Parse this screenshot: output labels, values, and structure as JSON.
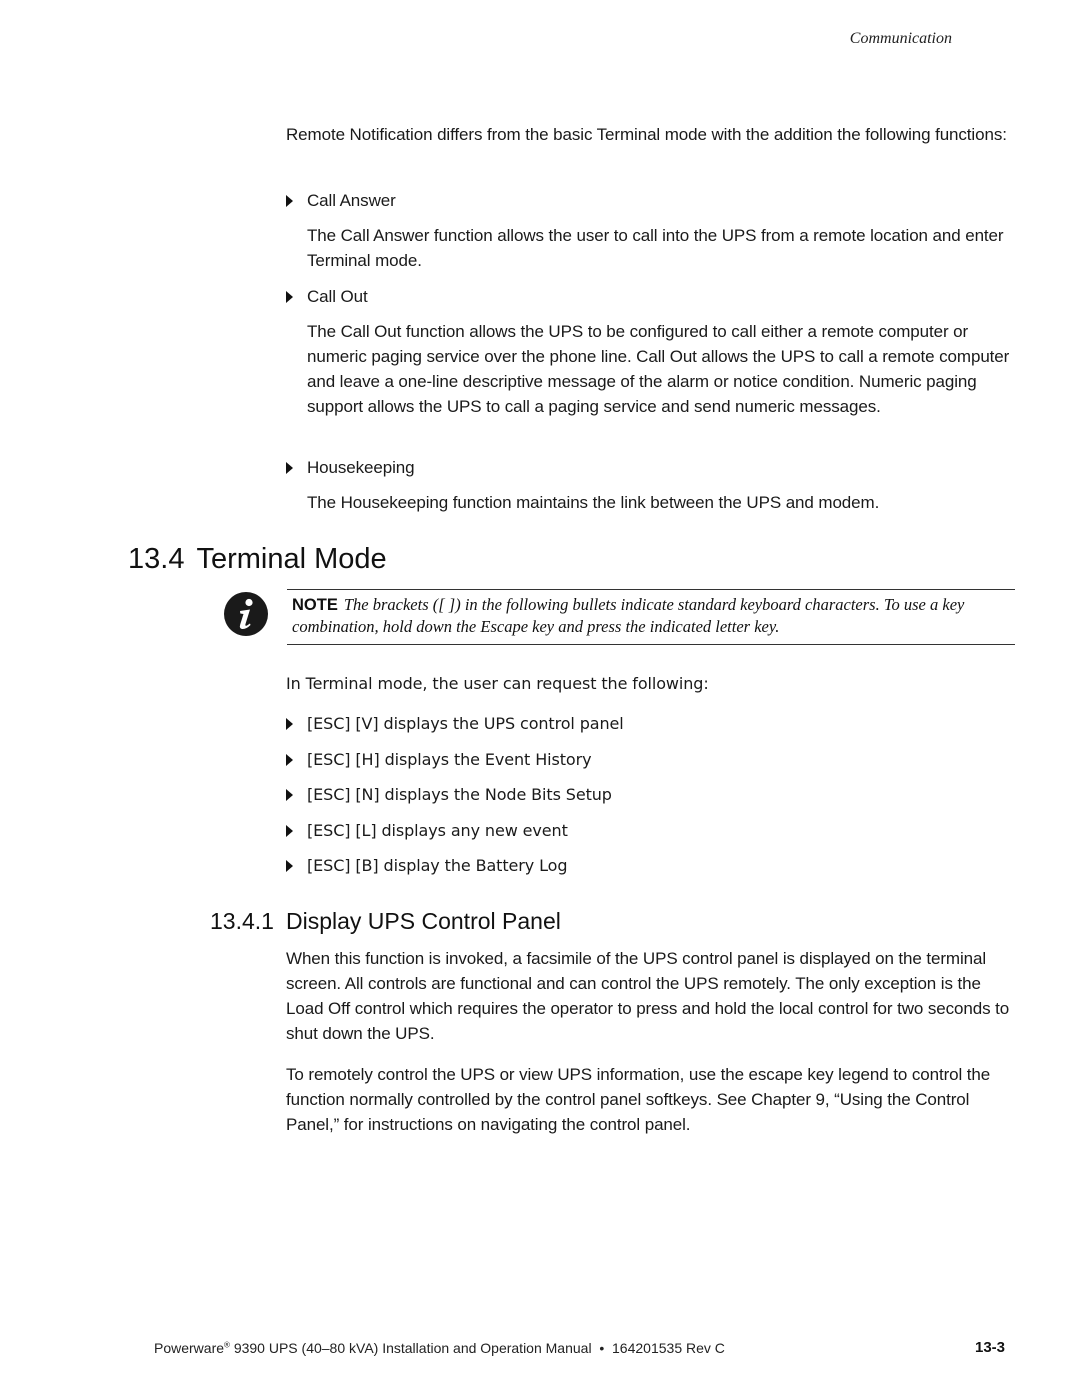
{
  "header": {
    "running_head": "Communication"
  },
  "intro": {
    "paragraph": "Remote Notification differs from the basic Terminal mode with the addition the following functions:",
    "functions": [
      {
        "label": "Call Answer",
        "description": "The Call Answer function allows the user to call into the UPS from a remote location and enter Terminal mode."
      },
      {
        "label": "Call Out",
        "description": "The Call Out function allows the UPS to be configured to call either a remote computer or numeric paging service over the phone line. Call Out allows the UPS to call a remote computer and leave a one-line descriptive message of the alarm or notice condition. Numeric paging support allows the UPS to call a paging service and send numeric messages."
      },
      {
        "label": "Housekeeping",
        "description": "The Housekeeping function maintains the link between the UPS and modem."
      }
    ]
  },
  "section": {
    "number": "13.4",
    "title": "Terminal Mode",
    "note": {
      "icon": "info-icon",
      "label": "NOTE",
      "text": "The brackets ([ ]) in the following bullets indicate standard keyboard characters. To use a key combination, hold down the Escape key and press the indicated letter key."
    },
    "lead": "In Terminal mode, the user can request the following:",
    "commands": [
      "[ESC] [V] displays the UPS control panel",
      "[ESC] [H] displays the Event History",
      "[ESC] [N] displays the Node Bits Setup",
      "[ESC] [L] displays any new event",
      "[ESC] [B] display the Battery Log"
    ]
  },
  "subsection": {
    "number": "13.4.1",
    "title": "Display UPS Control Panel",
    "paragraphs": [
      "When this function is invoked, a facsimile of the UPS control panel is displayed on the terminal screen. All controls are functional and can control the UPS remotely. The only exception is the Load Off control which requires the operator to press and hold the local control for two seconds to shut down the UPS.",
      "To remotely control the UPS or view UPS information, use the escape key legend to control the function normally controlled by the control panel softkeys. See Chapter 9, “Using the Control Panel,” for instructions on navigating the control panel."
    ]
  },
  "footer": {
    "brand": "Powerware",
    "registered": "®",
    "text": " 9390 UPS (40–80 kVA) Installation and Operation Manual  •  164201535 Rev C",
    "page_number": "13-3"
  }
}
